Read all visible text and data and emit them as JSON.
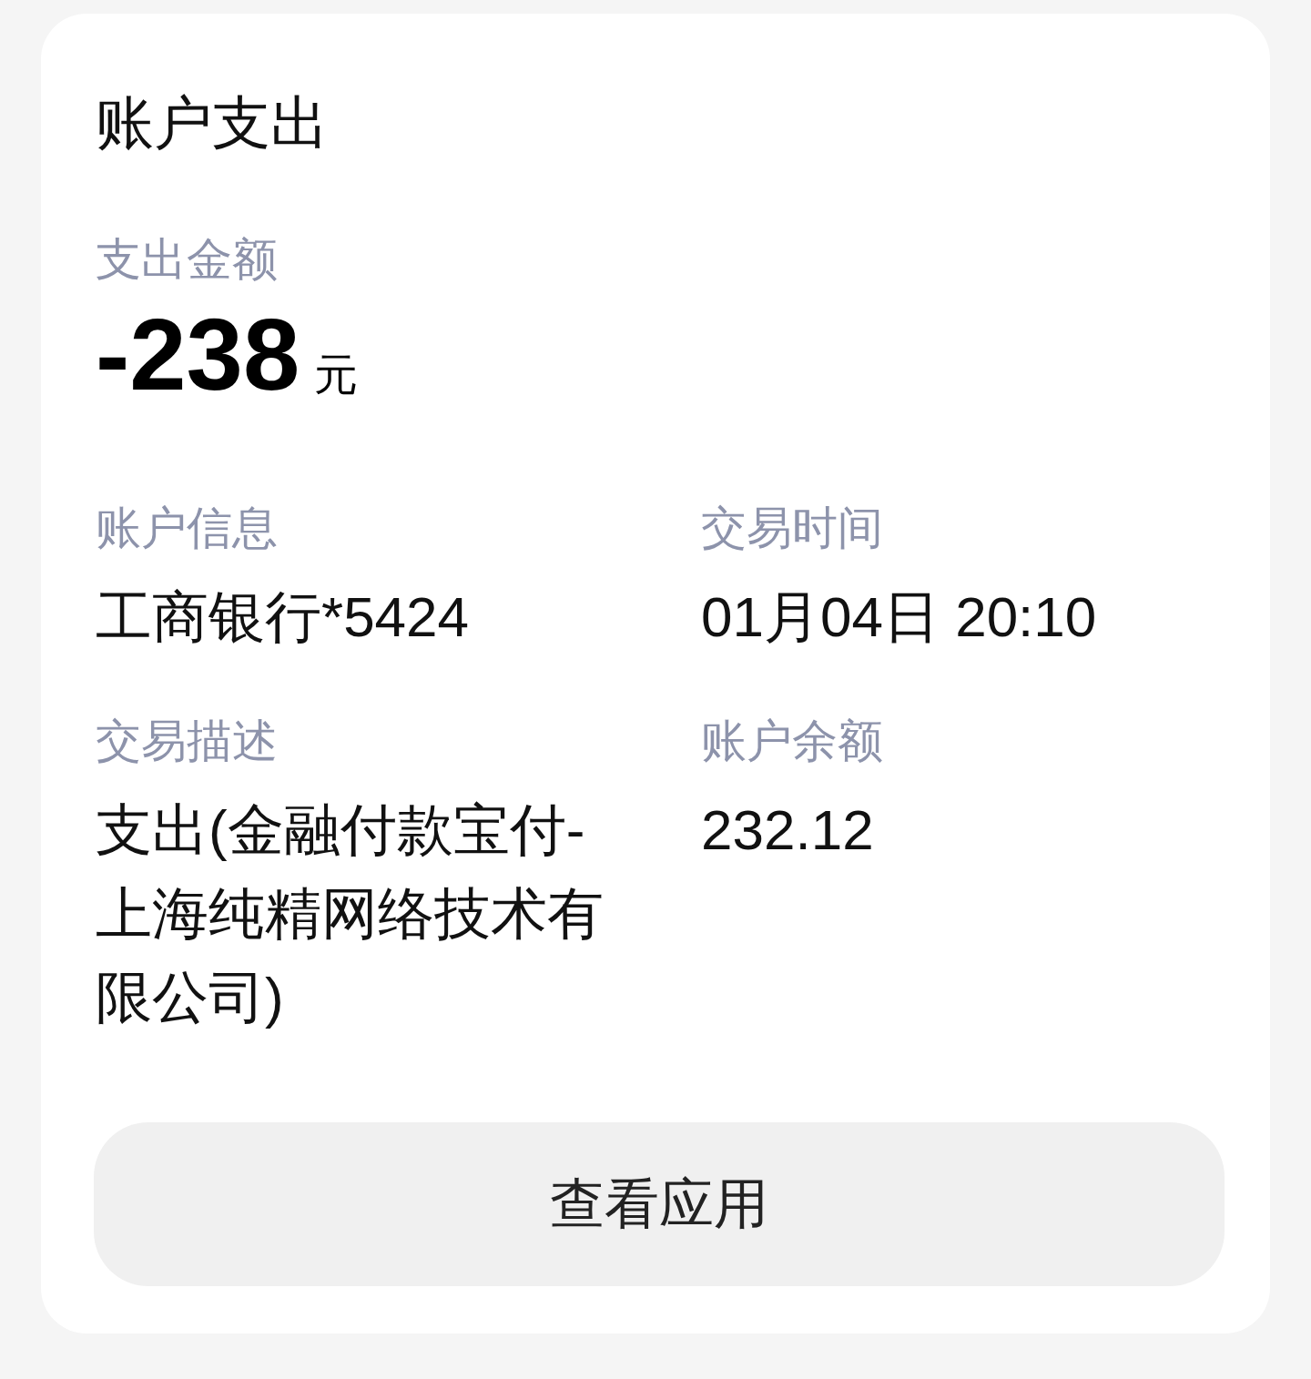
{
  "card": {
    "title": "账户支出",
    "amount": {
      "label": "支出金额",
      "value": "-238",
      "unit": "元"
    },
    "fields": [
      {
        "label": "账户信息",
        "value": "工商银行*5424"
      },
      {
        "label": "交易时间",
        "value": "01月04日 20:10"
      },
      {
        "label": "交易描述",
        "value": "支出(金融付款宝付-上海纯精网络技术有限公司)"
      },
      {
        "label": "账户余额",
        "value": "232.12"
      }
    ],
    "button": "查看应用"
  }
}
